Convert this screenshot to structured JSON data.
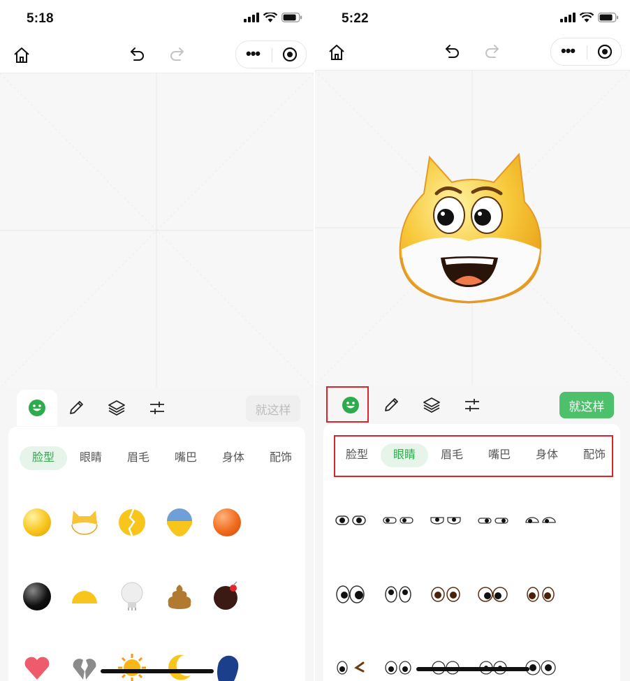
{
  "screens": [
    {
      "status": {
        "time": "5:18"
      },
      "toolbar": {
        "done_label": "就这样"
      },
      "categories": [
        "脸型",
        "眼睛",
        "眉毛",
        "嘴巴",
        "身体",
        "配饰"
      ],
      "active_category": "脸型",
      "grid_items": [
        "yellow-circle-face",
        "cat-head-face",
        "cracked-yellow-face",
        "blue-yellow-face",
        "orange-circle-face",
        "black-circle-face",
        "half-yellow-face",
        "lightbulb-face",
        "poop-face",
        "bomb-face",
        "heart-face",
        "broken-heart-face",
        "sun-face",
        "moon-face",
        "blue-head-face"
      ]
    },
    {
      "status": {
        "time": "5:22"
      },
      "toolbar": {
        "done_label": "就这样"
      },
      "categories": [
        "脸型",
        "眼睛",
        "眉毛",
        "嘴巴",
        "身体",
        "配饰"
      ],
      "active_category": "眼睛",
      "grid_items": [
        "eyes-style-1",
        "eyes-style-2",
        "eyes-style-3",
        "eyes-style-4",
        "eyes-style-5",
        "eyes-style-6",
        "eyes-style-7",
        "eyes-style-8",
        "eyes-style-9",
        "eyes-style-10",
        "eyes-style-11",
        "eyes-style-12",
        "eyes-style-13",
        "eyes-style-14",
        "eyes-style-15"
      ],
      "canvas_emoji": "cat-face-emoji"
    }
  ],
  "icons": {
    "home": "home-icon",
    "undo": "undo-icon",
    "redo": "redo-icon",
    "more": "more-dots-icon",
    "close": "target-circle-icon",
    "face": "face-tab-icon",
    "pencil": "pencil-icon",
    "layers": "layers-icon",
    "adjust": "sliders-icon"
  },
  "colors": {
    "accent": "#2faa4e",
    "accent_bg": "#e6f4ea",
    "highlight": "#d9232d",
    "done_disabled": "#bdbdbd",
    "done_active": "#4cc06a"
  }
}
